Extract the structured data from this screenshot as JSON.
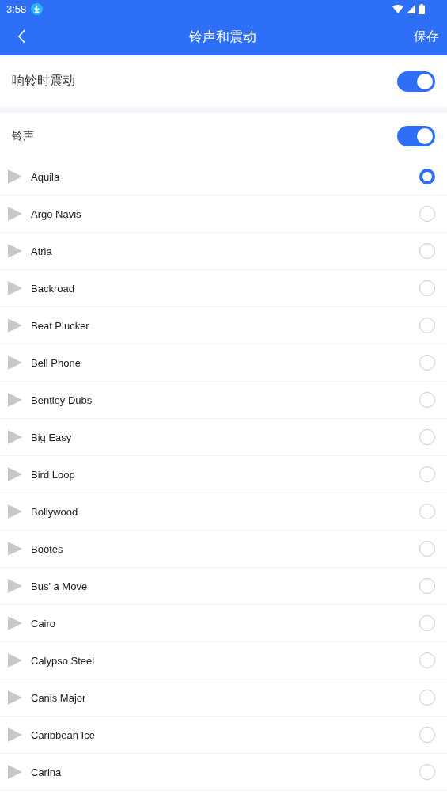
{
  "status_bar": {
    "time": "3:58"
  },
  "app_bar": {
    "title": "铃声和震动",
    "action": "保存"
  },
  "vibrate": {
    "label": "响铃时震动",
    "on": true
  },
  "ringtone": {
    "label": "铃声",
    "on": true
  },
  "ringtones": [
    {
      "name": "Aquila",
      "selected": true
    },
    {
      "name": "Argo Navis",
      "selected": false
    },
    {
      "name": "Atria",
      "selected": false
    },
    {
      "name": "Backroad",
      "selected": false
    },
    {
      "name": "Beat Plucker",
      "selected": false
    },
    {
      "name": "Bell Phone",
      "selected": false
    },
    {
      "name": "Bentley Dubs",
      "selected": false
    },
    {
      "name": "Big Easy",
      "selected": false
    },
    {
      "name": "Bird Loop",
      "selected": false
    },
    {
      "name": "Bollywood",
      "selected": false
    },
    {
      "name": "Boötes",
      "selected": false
    },
    {
      "name": "Bus' a Move",
      "selected": false
    },
    {
      "name": "Cairo",
      "selected": false
    },
    {
      "name": "Calypso Steel",
      "selected": false
    },
    {
      "name": "Canis Major",
      "selected": false
    },
    {
      "name": "Caribbean Ice",
      "selected": false
    },
    {
      "name": "Carina",
      "selected": false
    }
  ]
}
